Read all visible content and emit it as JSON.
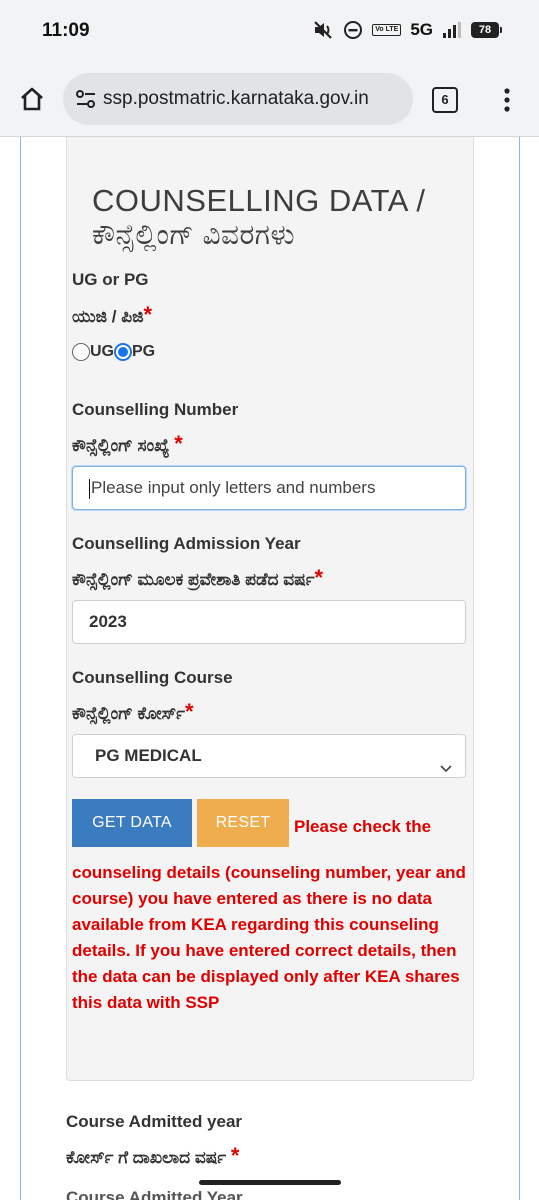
{
  "status_bar": {
    "time": "11:09",
    "network": "5G",
    "volte": "Vo LTE",
    "battery": "78",
    "icons": [
      "mute-icon",
      "dnd-icon",
      "signal-icon",
      "battery-icon"
    ]
  },
  "browser": {
    "url": "ssp.postmatric.karnataka.gov.in",
    "tab_count": "6",
    "icons": [
      "home-icon",
      "site-settings-icon",
      "tabs-icon",
      "menu-icon"
    ]
  },
  "form": {
    "heading_en": "COUNSELLING DATA /",
    "heading_kn": "ಕೌನ್ಸೆಲ್ಲಿಂಗ್ ವಿವರಗಳು",
    "ugpg": {
      "label_en": "UG or PG",
      "label_kn": "ಯುಜಿ / ಪಿಜಿ",
      "required": "*",
      "options": [
        "UG",
        "PG"
      ],
      "selected": "PG"
    },
    "number": {
      "label_en": "Counselling Number",
      "label_kn": "ಕೌನ್ಸೆಲ್ಲಿಂಗ್ ಸಂಖ್ಯೆ",
      "required": "*",
      "value": "",
      "placeholder": "Please input only letters and numbers"
    },
    "year": {
      "label_en": "Counselling Admission Year",
      "label_kn": "ಕೌನ್ಸೆಲ್ಲಿಂಗ್ ಮೂಲಕ ಪ್ರವೇಶಾತಿ ಪಡೆದ ವರ್ಷ",
      "required": "*",
      "value": "2023"
    },
    "course": {
      "label_en": "Counselling Course",
      "label_kn": "ಕೌನ್ಸೆಲ್ಲಿಂಗ್ ಕೋರ್ಸ್",
      "required": "*",
      "selected": "PG MEDICAL"
    },
    "buttons": {
      "get_data": "GET DATA",
      "reset": "RESET"
    },
    "error_line1": "Please check the",
    "error_rest": "counseling details (counseling number, year and course) you have entered as there is no data available from KEA regarding this counseling details. If you have entered correct details, then the data can be displayed only after KEA shares this data with SSP"
  },
  "next_section": {
    "label_en": "Course Admitted year",
    "label_kn": "ಕೋರ್ಸ್ ಗೆ ದಾಖಲಾದ ವರ್ಷ",
    "required": "*",
    "cut_label": "Course Admitted Year"
  }
}
